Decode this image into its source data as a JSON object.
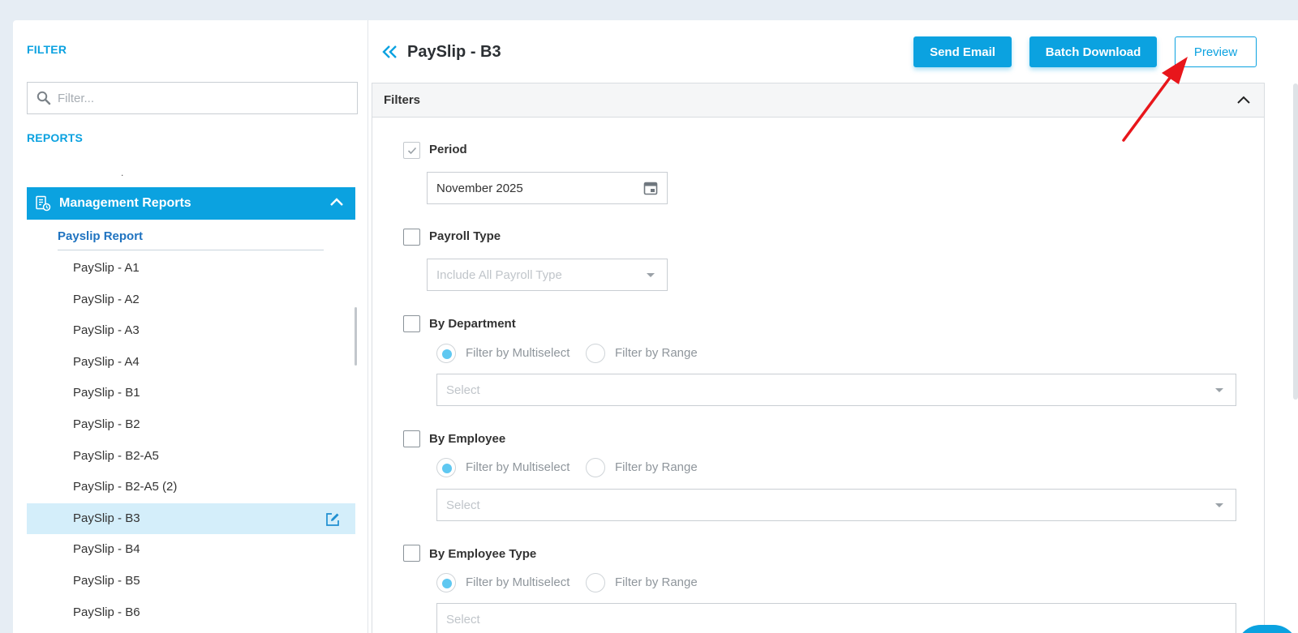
{
  "sidebar": {
    "filter_label": "FILTER",
    "filter_placeholder": "Filter...",
    "reports_label": "REPORTS",
    "dot": ".",
    "group_title": "Management Reports",
    "sub_header": "Payslip Report",
    "items": [
      {
        "label": "PaySlip - A1"
      },
      {
        "label": "PaySlip - A2"
      },
      {
        "label": "PaySlip - A3"
      },
      {
        "label": "PaySlip - A4"
      },
      {
        "label": "PaySlip - B1"
      },
      {
        "label": "PaySlip - B2"
      },
      {
        "label": "PaySlip - B2-A5"
      },
      {
        "label": "PaySlip - B2-A5 (2)"
      },
      {
        "label": "PaySlip - B3",
        "active": true
      },
      {
        "label": "PaySlip - B4"
      },
      {
        "label": "PaySlip - B5"
      },
      {
        "label": "PaySlip - B6"
      }
    ]
  },
  "main": {
    "title": "PaySlip - B3",
    "buttons": {
      "send_email": "Send Email",
      "batch_download": "Batch Download",
      "preview": "Preview"
    },
    "filters": {
      "title": "Filters",
      "period": {
        "label": "Period",
        "value": "November 2025",
        "checked": true
      },
      "payroll_type": {
        "label": "Payroll Type",
        "placeholder": "Include All Payroll Type"
      },
      "by_department": {
        "label": "By Department",
        "opt_multi": "Filter by Multiselect",
        "opt_range": "Filter by Range",
        "placeholder": "Select"
      },
      "by_employee": {
        "label": "By Employee",
        "opt_multi": "Filter by Multiselect",
        "opt_range": "Filter by Range",
        "placeholder": "Select"
      },
      "by_employee_type": {
        "label": "By Employee Type",
        "opt_multi": "Filter by Multiselect",
        "opt_range": "Filter by Range",
        "placeholder": "Select"
      }
    }
  },
  "colors": {
    "accent": "#0ba2e0",
    "active_row": "#d4eefa",
    "annotation_arrow": "#e8161b"
  }
}
